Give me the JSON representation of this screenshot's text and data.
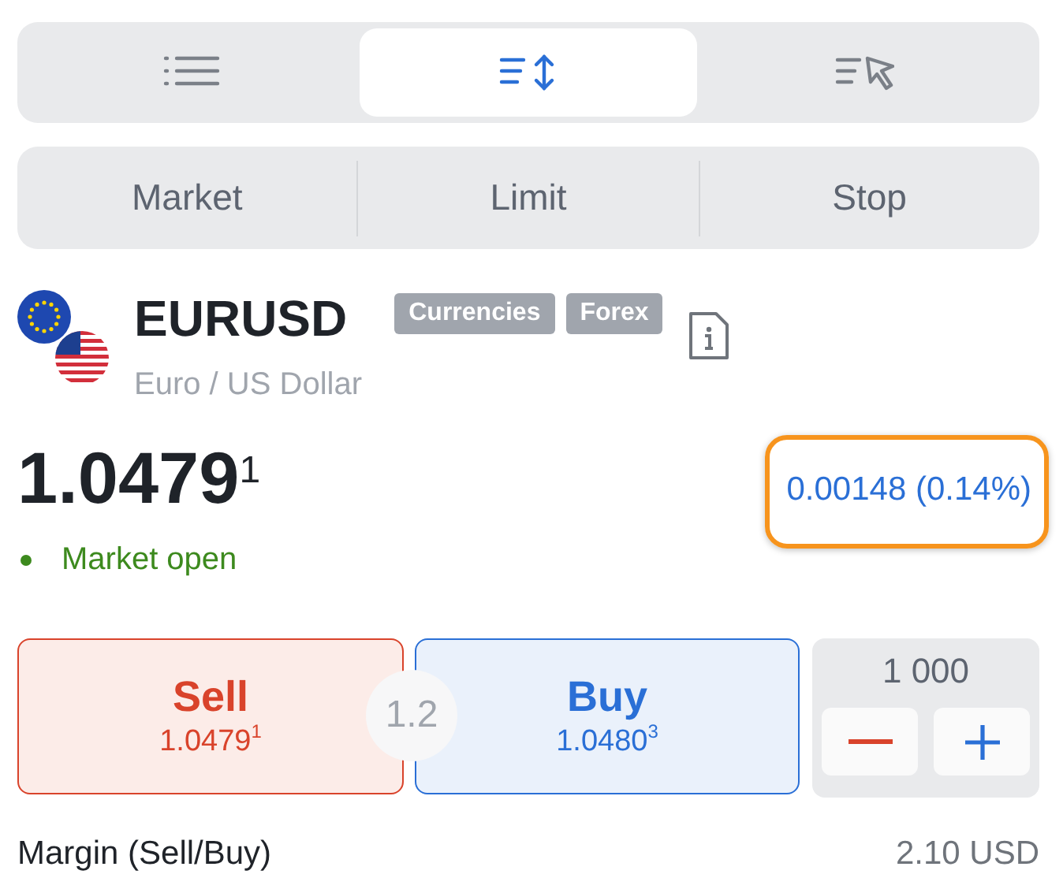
{
  "view_tabs": [
    {
      "kind": "list",
      "selected": false
    },
    {
      "kind": "sort",
      "selected": true
    },
    {
      "kind": "select",
      "selected": false
    }
  ],
  "order_types": [
    "Market",
    "Limit",
    "Stop"
  ],
  "instrument": {
    "symbol": "EURUSD",
    "tags": [
      "Currencies",
      "Forex"
    ],
    "name": "Euro / US Dollar"
  },
  "price": "1.0479$^{1}$",
  "change": {
    "text": "0.00148 (0.14%)",
    "highlighted": true
  },
  "market_status": {
    "text": "Market open",
    "open": true
  },
  "sell": {
    "label": "Sell",
    "price": "1.0479$^{1}$"
  },
  "spread": "1.2",
  "buy": {
    "label": "Buy",
    "price": "1.0480$^{3}$"
  },
  "quantity": {
    "value": "1 000"
  },
  "margin": {
    "label": "Margin (Sell/Buy)",
    "value": "2.10 USD"
  }
}
